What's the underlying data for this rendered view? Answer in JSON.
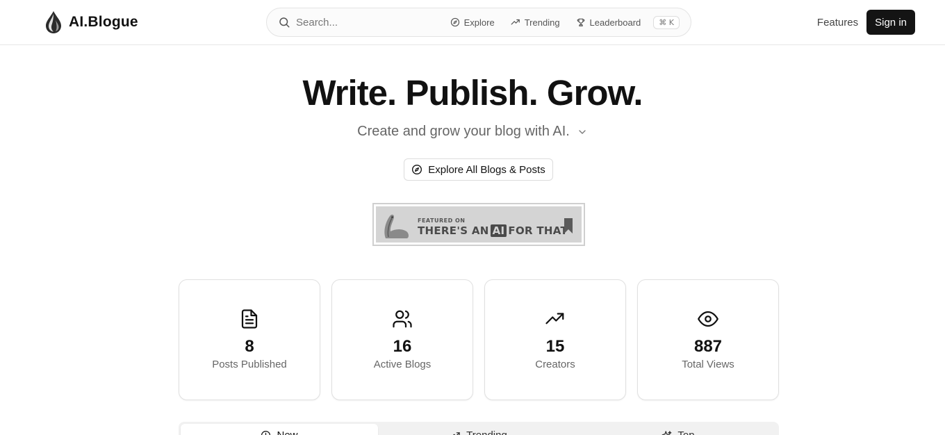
{
  "brand": {
    "name": "AI.Blogue"
  },
  "search": {
    "placeholder": "Search...",
    "shortcut": "⌘ K"
  },
  "quick_links": [
    {
      "label": "Explore",
      "icon": "compass-icon"
    },
    {
      "label": "Trending",
      "icon": "trending-up-icon"
    },
    {
      "label": "Leaderboard",
      "icon": "trophy-icon"
    }
  ],
  "nav": {
    "features": "Features",
    "signin": "Sign in"
  },
  "hero": {
    "title": "Write. Publish. Grow.",
    "subtitle": "Create and grow your blog with AI.",
    "explore_button": "Explore All Blogs & Posts"
  },
  "badge": {
    "small_text": "FEATURED ON",
    "main_pre": "THERE'S AN",
    "main_ai": "AI",
    "main_post": "FOR THAT"
  },
  "stats": [
    {
      "value": "8",
      "label": "Posts Published",
      "icon": "file-text-icon"
    },
    {
      "value": "16",
      "label": "Active Blogs",
      "icon": "users-icon"
    },
    {
      "value": "15",
      "label": "Creators",
      "icon": "trending-up-icon"
    },
    {
      "value": "887",
      "label": "Total Views",
      "icon": "eye-icon"
    }
  ],
  "tabs": [
    {
      "label": "New",
      "icon": "clock-icon",
      "active": true
    },
    {
      "label": "Trending",
      "icon": "trending-up-icon",
      "active": false
    },
    {
      "label": "Top",
      "icon": "sparkles-icon",
      "active": false
    }
  ],
  "colors": {
    "primary": "#141414",
    "muted_text": "#666666",
    "border": "#e0e0e0"
  }
}
